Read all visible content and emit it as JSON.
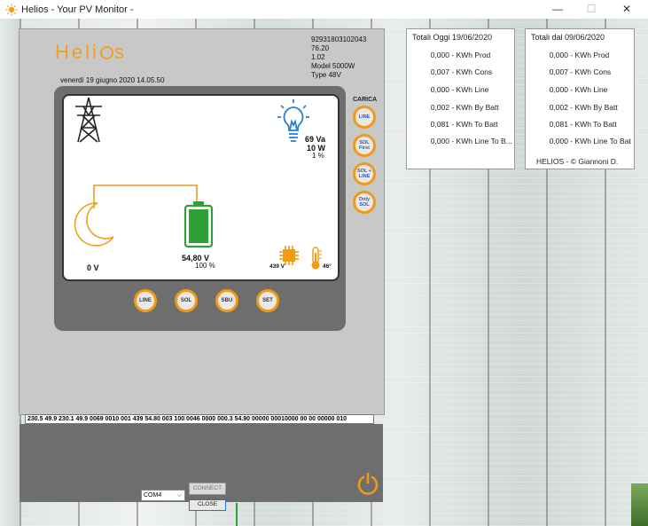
{
  "window": {
    "title": "Helios  -  Your PV Monitor  -",
    "min": "—",
    "max": "☐",
    "close": "✕"
  },
  "device": {
    "logo": "Helios",
    "serial": "92931803102043",
    "version1": "76.20",
    "version2": "1.02",
    "model": "Model 5000W",
    "type": "Type 48V",
    "datetime": "venerdì 19 giugno 2020 14.05.50",
    "carica_label": "CARICA",
    "side_buttons": [
      {
        "label": "LINE"
      },
      {
        "label": "SOL First"
      },
      {
        "label": "SOL + LINE"
      },
      {
        "label": "Only SOL"
      }
    ],
    "bottom_buttons": [
      {
        "label": "LINE"
      },
      {
        "label": "SOL"
      },
      {
        "label": "SBU"
      },
      {
        "label": "SET"
      }
    ],
    "load_va": "69 Va",
    "load_w": "10 W",
    "load_pct": "1 %",
    "solar_v": "0 V",
    "battery_v": "54,80 V",
    "battery_pct": "100 %",
    "bus_v": "439 V",
    "temp": "46°",
    "data_line": "230.5 49.9 230.1 49.9 0069 0010 001 439 54.80 003 100 0046 0000 000.3 54.90 00000 00010000 00 00 00000 010",
    "com_port": "COM4",
    "connect_label": "CONNECT",
    "close_label": "CLOSE"
  },
  "totals_today": {
    "title": "Totali Oggi 19/06/2020",
    "rows": [
      {
        "value": "0,000",
        "label": " - KWh Prod"
      },
      {
        "value": "0,007",
        "label": " - KWh Cons"
      },
      {
        "value": "0,000",
        "label": " - KWh  Line"
      },
      {
        "value": "0,002",
        "label": " - KWh By Batt"
      },
      {
        "value": "0,081",
        "label": " - KWh To Batt"
      },
      {
        "value": "0,000",
        "label": " - KWh Line To B..."
      }
    ]
  },
  "totals_since": {
    "title": "Totali dal 09/06/2020",
    "rows": [
      {
        "value": "0,000",
        "label": " - KWh Prod"
      },
      {
        "value": "0,007",
        "label": " - KWh Cons"
      },
      {
        "value": "0,000",
        "label": " - KWh  Line"
      },
      {
        "value": "0,002",
        "label": " - KWh By Batt"
      },
      {
        "value": "0,081",
        "label": " - KWh To Batt"
      },
      {
        "value": "0,000",
        "label": " - KWh Line To Bat"
      }
    ],
    "copyright": "HELIOS - © Giannoni D."
  },
  "colors": {
    "accent": "#f39a14",
    "battery": "#2fa035",
    "sun": "#f0a020",
    "bulb": "#2a7fd6"
  },
  "icons": [
    "sun-app-icon",
    "power-pylon-icon",
    "light-bulb-icon",
    "moon-icon",
    "battery-icon",
    "chip-icon",
    "thermometer-icon",
    "power-icon"
  ]
}
